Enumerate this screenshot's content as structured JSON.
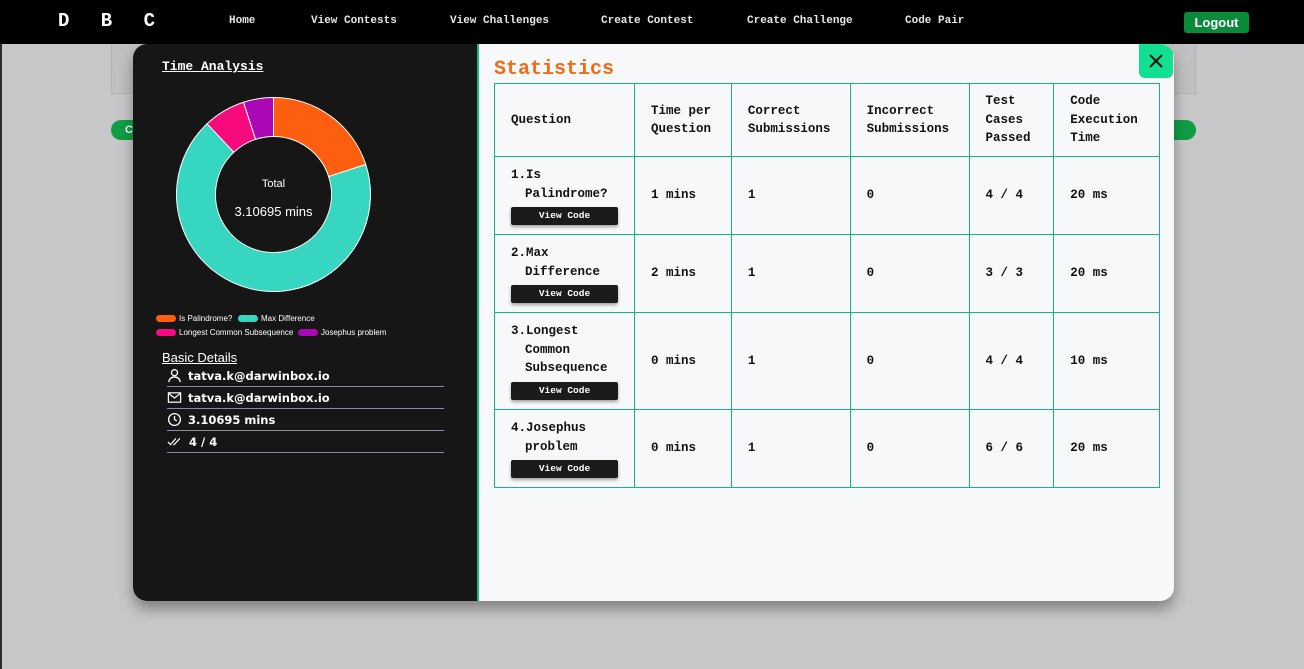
{
  "nav": {
    "brand": "D B C",
    "links": [
      "Home",
      "View Contests",
      "View Challenges",
      "Create Contest",
      "Create Challenge",
      "Code Pair"
    ],
    "logout": "Logout"
  },
  "background": {
    "pill_text": "C"
  },
  "time_analysis": {
    "title": "Time Analysis",
    "total_label": "Total",
    "total_value": "3.10695 mins",
    "legend": [
      "Is Palindrome?",
      "Max Difference",
      "Longest Common Subsequence",
      "Josephus problem"
    ],
    "colors": [
      "#fd5e0f",
      "#37d6c0",
      "#f80a7f",
      "#aa08b5"
    ]
  },
  "chart_data": {
    "type": "pie",
    "categories": [
      "Is Palindrome?",
      "Max Difference",
      "Longest Common Subsequence",
      "Josephus problem"
    ],
    "values": [
      0.2,
      0.68,
      0.07,
      0.05
    ],
    "title": "Time Analysis",
    "center_label": "Total",
    "center_value": "3.10695 mins",
    "legend": "bottom"
  },
  "basic_details": {
    "title": "Basic Details",
    "username": "tatva.k@darwinbox.io",
    "email": "tatva.k@darwinbox.io",
    "time": "3.10695 mins",
    "passed": "4 / 4"
  },
  "statistics": {
    "title": "Statistics",
    "view_code_label": "View Code",
    "headers": [
      "Question",
      "Time per Question",
      "Correct Submissions",
      "Incorrect Submissions",
      "Test Cases Passed",
      "Code Execution Time"
    ],
    "rows": [
      {
        "question": "1.Is Palindrome?",
        "time": "1 mins",
        "correct": "1",
        "incorrect": "0",
        "tests": "4 / 4",
        "exec": "20 ms"
      },
      {
        "question": "2.Max Difference",
        "time": "2 mins",
        "correct": "1",
        "incorrect": "0",
        "tests": "3 / 3",
        "exec": "20 ms"
      },
      {
        "question": "3.Longest Common Subsequence",
        "time": "0 mins",
        "correct": "1",
        "incorrect": "0",
        "tests": "4 / 4",
        "exec": "10 ms"
      },
      {
        "question": "4.Josephus problem",
        "time": "0 mins",
        "correct": "1",
        "incorrect": "0",
        "tests": "6 / 6",
        "exec": "20 ms"
      }
    ]
  }
}
